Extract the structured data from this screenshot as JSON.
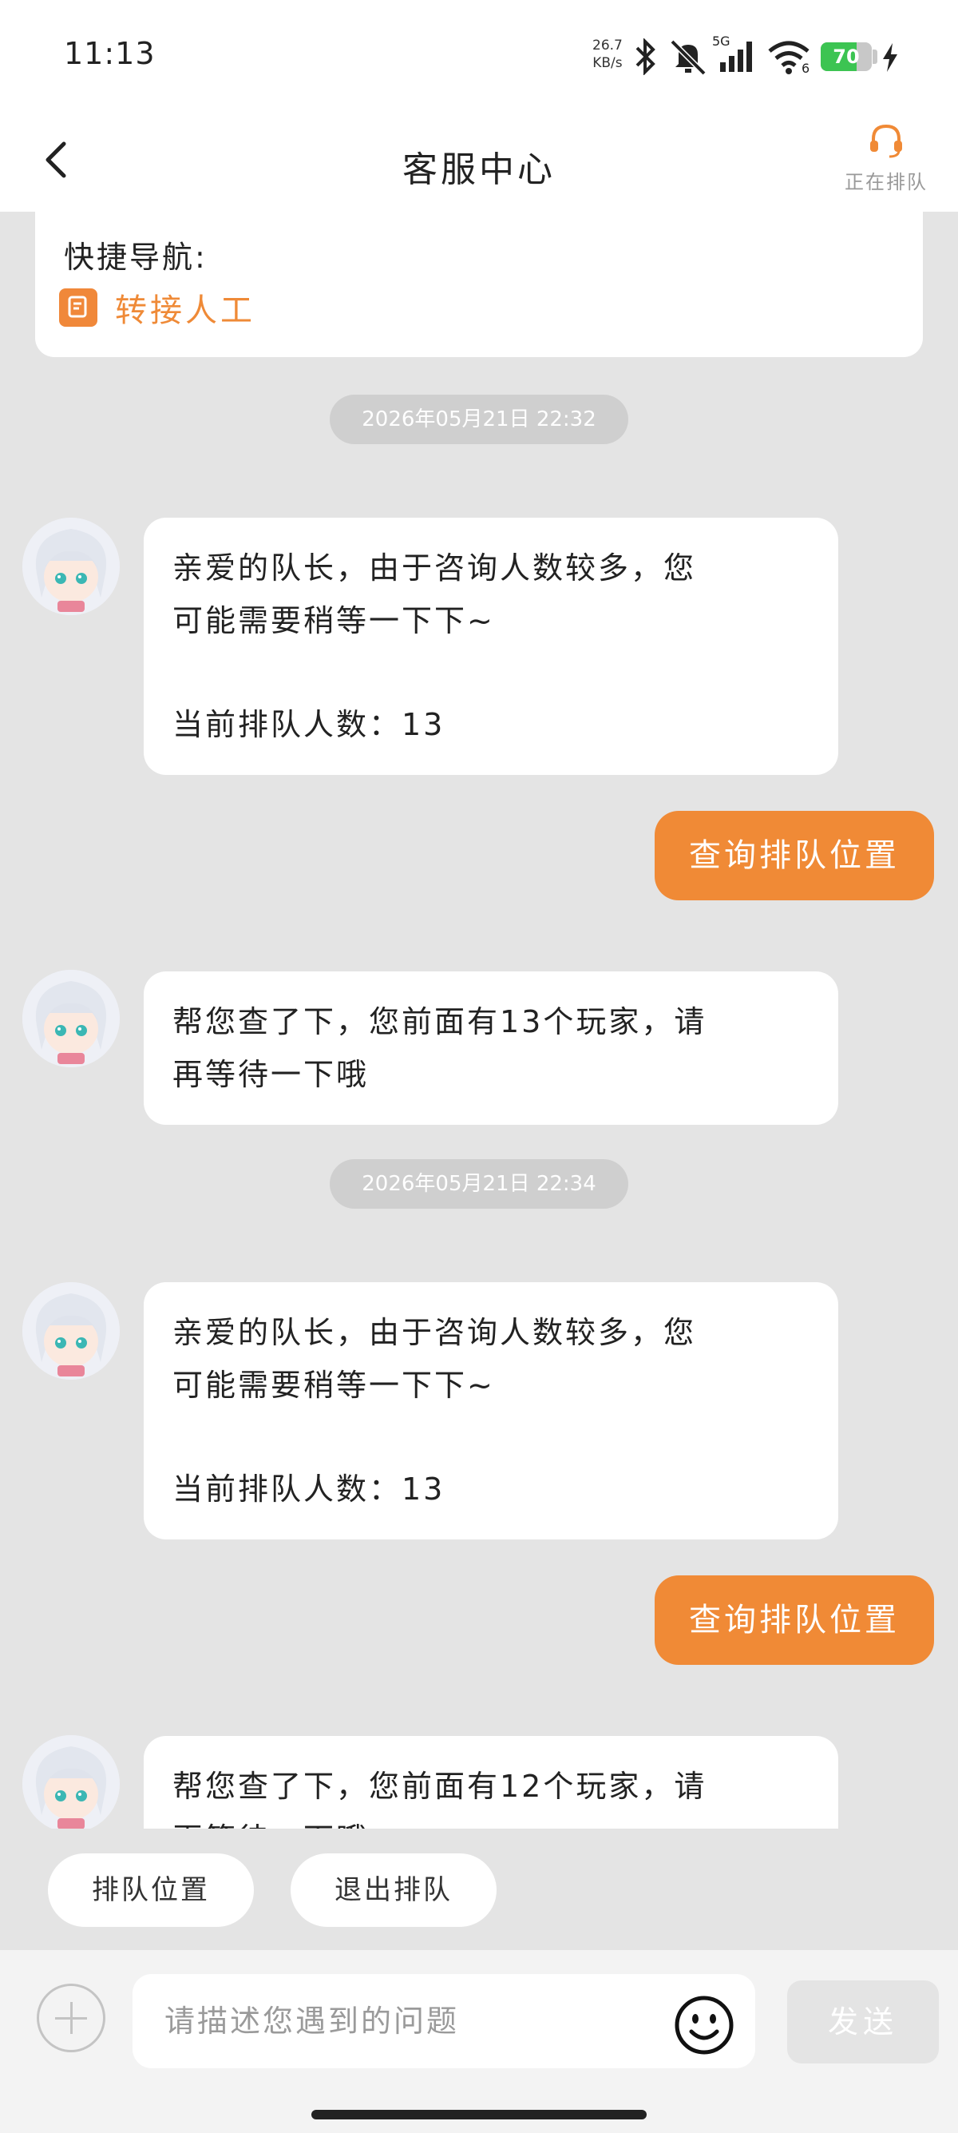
{
  "status_bar": {
    "time": "11:13",
    "net_speed_value": "26.7",
    "net_speed_unit": "KB/s",
    "signal_label": "5G",
    "wifi_label": "6",
    "battery_level": "70",
    "icons": [
      "bluetooth-icon",
      "mute-icon",
      "signal-icon",
      "wifi-icon",
      "battery-icon",
      "charging-icon"
    ]
  },
  "header": {
    "title": "客服中心",
    "queue_status": "正在排队",
    "accent_color": "#f08a36"
  },
  "nav_card": {
    "title": "快捷导航:",
    "link_label": "转接人工"
  },
  "messages": [
    {
      "type": "timestamp",
      "text": "2026年05月21日  22:32"
    },
    {
      "type": "agent",
      "lines": [
        "亲爱的队长，由于咨询人数较多，您",
        "可能需要稍等一下下~"
      ],
      "extra": "当前排队人数：13"
    },
    {
      "type": "user",
      "text": "查询排队位置"
    },
    {
      "type": "agent",
      "lines": [
        "帮您查了下，您前面有13个玩家，请",
        "再等待一下哦"
      ]
    },
    {
      "type": "timestamp",
      "text": "2026年05月21日  22:34"
    },
    {
      "type": "agent",
      "lines": [
        "亲爱的队长，由于咨询人数较多，您",
        "可能需要稍等一下下~"
      ],
      "extra": "当前排队人数：13"
    },
    {
      "type": "user",
      "text": "查询排队位置"
    },
    {
      "type": "agent",
      "lines": [
        "帮您查了下，您前面有12个玩家，请",
        "再等待一下哦"
      ]
    }
  ],
  "quick_actions": [
    "排队位置",
    "退出排队"
  ],
  "input": {
    "placeholder": "请描述您遇到的问题",
    "send_label": "发送"
  }
}
